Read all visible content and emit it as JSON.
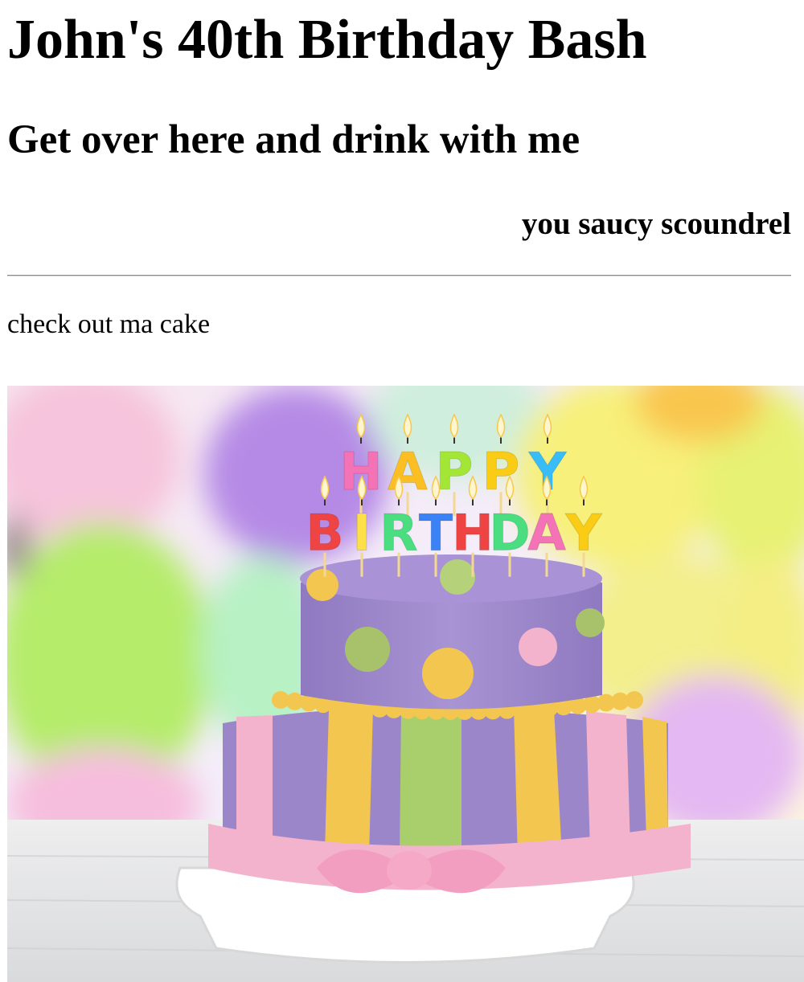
{
  "page": {
    "title": "John's 40th Birthday Bash",
    "subtitle": "Get over here and drink with me",
    "tagline": "you saucy scoundrel",
    "caption": "check out ma cake"
  },
  "photo": {
    "top_letters": [
      "H",
      "A",
      "P",
      "P",
      "Y"
    ],
    "bottom_letters": [
      "B",
      "I",
      "R",
      "T",
      "H",
      "D",
      "A",
      "Y"
    ],
    "top_letter_colors": [
      "#f472b6",
      "#fbbf24",
      "#a3e635",
      "#facc15",
      "#38bdf8"
    ],
    "bottom_letter_colors": [
      "#ef4444",
      "#fde047",
      "#4ade80",
      "#3b82f6",
      "#ef4444",
      "#4ade80",
      "#f472b6",
      "#facc15"
    ],
    "colors": {
      "cake_purple": "#9b86c9",
      "ribbon_pink": "#f4b3cc",
      "stripe_yellow": "#f2c64f",
      "stripe_green": "#a8cf6b"
    }
  }
}
